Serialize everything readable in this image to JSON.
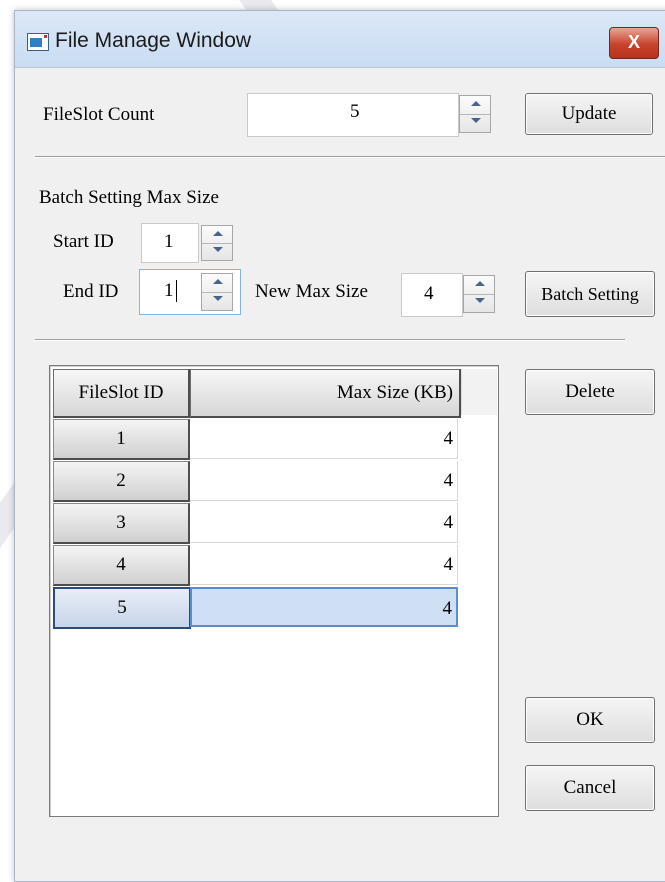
{
  "window": {
    "title": "File Manage Window",
    "close_label": "X"
  },
  "fileslot": {
    "label": "FileSlot Count",
    "value": "5",
    "update_label": "Update"
  },
  "batch": {
    "heading": "Batch Setting Max Size",
    "start_label": "Start ID",
    "start_value": "1",
    "end_label": "End ID",
    "end_value": "1",
    "newmax_label": "New Max Size",
    "newmax_value": "4",
    "button_label": "Batch Setting"
  },
  "table": {
    "columns": [
      "FileSlot ID",
      "Max Size (KB)"
    ],
    "rows": [
      {
        "id": "1",
        "size": "4"
      },
      {
        "id": "2",
        "size": "4"
      },
      {
        "id": "3",
        "size": "4"
      },
      {
        "id": "4",
        "size": "4"
      },
      {
        "id": "5",
        "size": "4"
      }
    ],
    "selected_row": "5"
  },
  "buttons": {
    "delete": "Delete",
    "ok": "OK",
    "cancel": "Cancel"
  },
  "colors": {
    "title_bar": "#c9dcf2",
    "close_button": "#c7432b",
    "selection": "#cfe0f5",
    "dialog_bg": "#f0f0f0"
  },
  "icons": {
    "window_icon": "app-window-icon",
    "close_icon": "close-icon"
  }
}
